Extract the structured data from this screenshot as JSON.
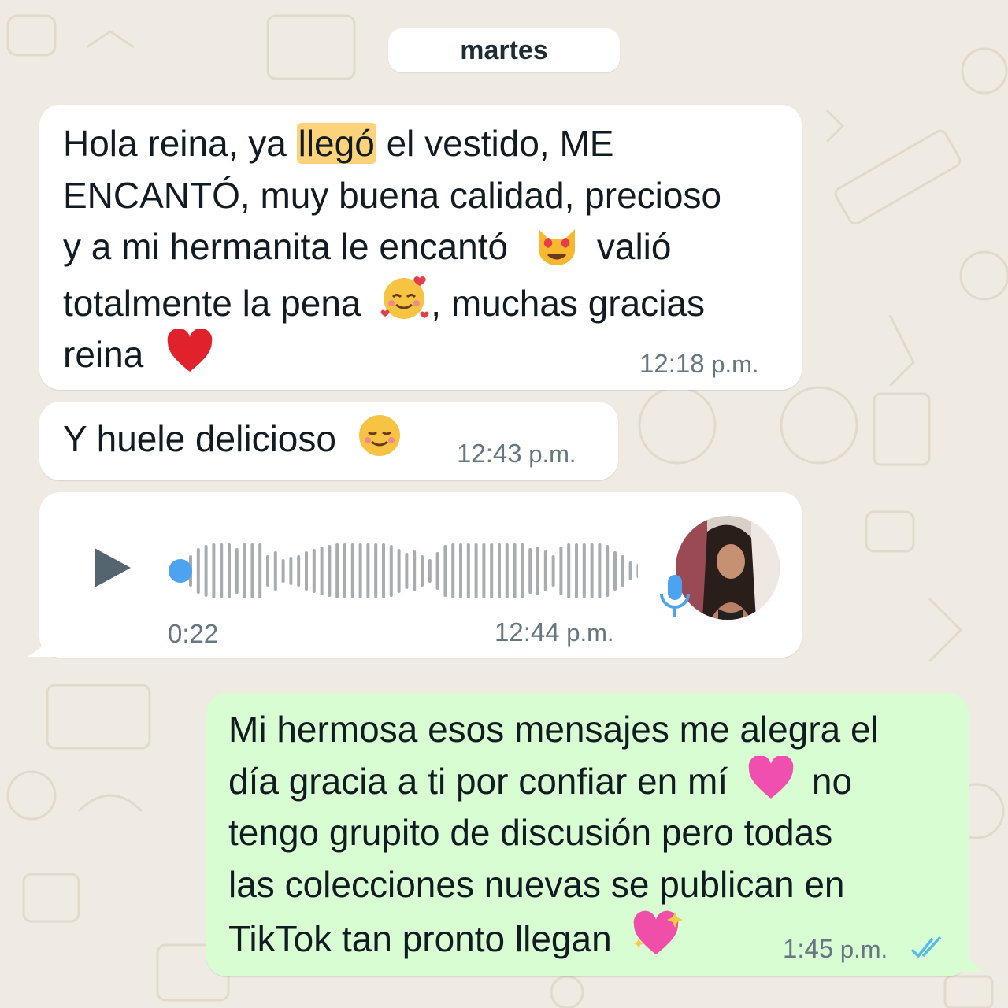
{
  "date_divider": "martes",
  "messages": [
    {
      "lines": [
        [
          "Hola reina, ya ",
          "llegó",
          " el vestido, ME"
        ],
        "ENCANTÓ, muy buena calidad, precioso",
        "y a mi hermanita le encantó",
        "valió",
        "totalmente la pena",
        ", muchas gracias",
        "reina"
      ],
      "time": "12:18",
      "time_suffix": "p.m."
    },
    {
      "text": "Y huele delicioso",
      "time": "12:43",
      "time_suffix": "p.m."
    },
    {
      "voice": {
        "duration": "0:22",
        "progress_fraction": 0.0
      },
      "time": "12:44",
      "time_suffix": "p.m."
    },
    {
      "lines": [
        "Mi hermosa esos mensajes me alegra el",
        "día gracia a ti por confiar en mí",
        "no",
        "tengo grupito de discusión pero todas",
        "las colecciones nuevas se publican en",
        "TikTok tan pronto llegan"
      ],
      "time": "1:45",
      "time_suffix": "p.m.",
      "status": "read"
    }
  ],
  "icons": {
    "heart_eyes_cat": "heart-eyes-cat-emoji",
    "smiling_hearts": "smiling-face-with-hearts-emoji",
    "red_heart": "red-heart-emoji",
    "relieved": "smiling-face-emoji",
    "pink_heart": "pink-heart-emoji",
    "sparkling_heart": "sparkling-heart-emoji",
    "play": "play-icon",
    "mic": "microphone-icon",
    "read_ticks": "double-check-icon"
  },
  "colors": {
    "background": "#efeae2",
    "incoming_bubble": "#ffffff",
    "outgoing_bubble": "#d9fdd3",
    "highlight": "#fcd27a",
    "read_ticks": "#53bdeb",
    "voice_dot": "#4da3f0"
  }
}
